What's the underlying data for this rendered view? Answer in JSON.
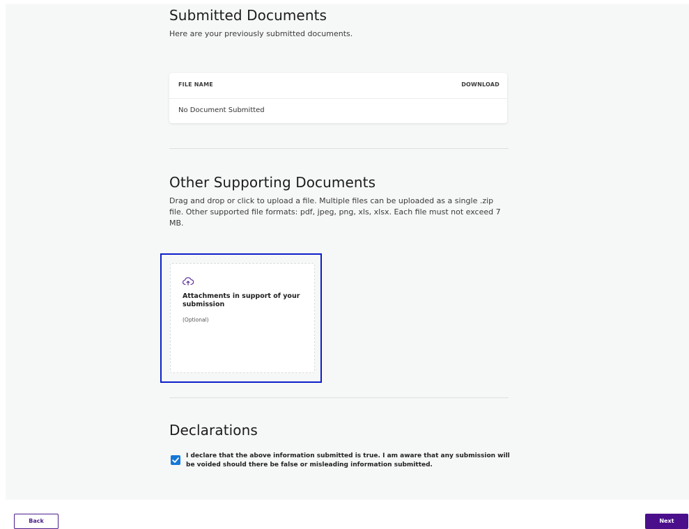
{
  "submitted_documents": {
    "title": "Submitted Documents",
    "description": "Here are your previously submitted documents.",
    "table": {
      "columns": [
        "FILE NAME",
        "DOWNLOAD"
      ],
      "empty_text": "No Document Submitted"
    }
  },
  "other_supporting_documents": {
    "title": "Other Supporting Documents",
    "description": "Drag and drop or click to upload a file. Multiple files can be uploaded as a single .zip file. Other supported file formats: pdf, jpeg, png, xls, xlsx. Each file must not exceed 7 MB.",
    "upload_card": {
      "icon": "cloud-upload-icon",
      "label": "Attachments in support of your submission",
      "optional_text": "(Optional)"
    }
  },
  "declarations": {
    "title": "Declarations",
    "checked": true,
    "text": "I declare that the above information submitted is true. I am aware that any submission will be voided should there be false or misleading information submitted."
  },
  "footer": {
    "back_label": "Back",
    "next_label": "Next"
  },
  "colors": {
    "accent": "#4b0f8c",
    "checkbox": "#1677d6",
    "focus_outline": "#0a1ec9",
    "content_bg": "#f6f7f7"
  }
}
